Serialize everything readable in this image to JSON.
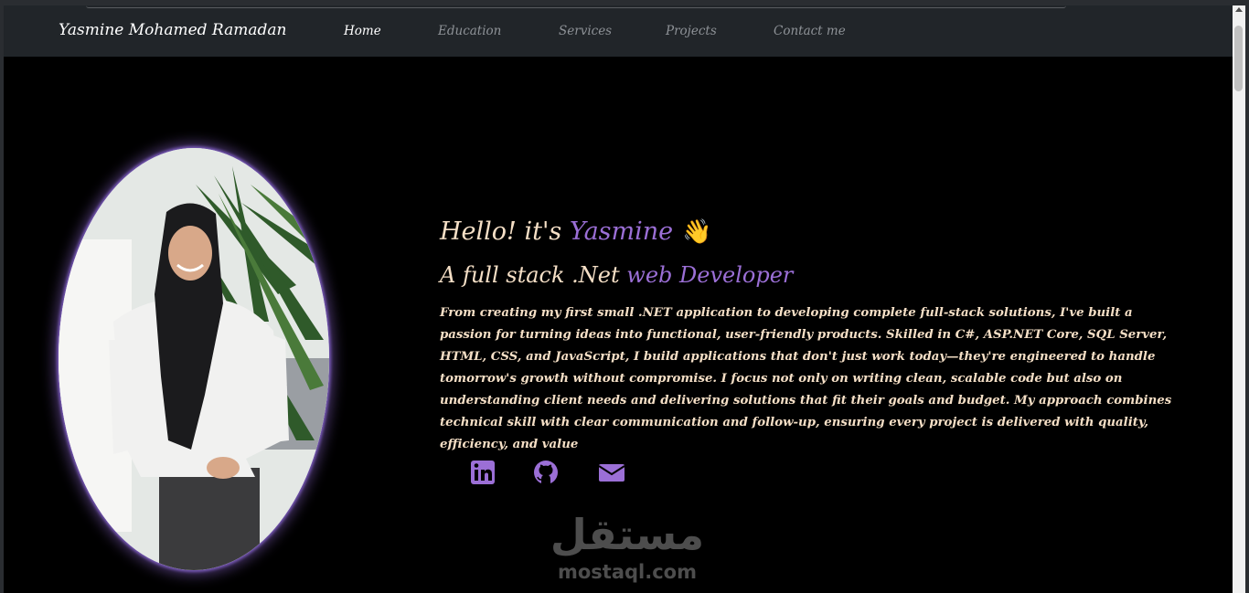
{
  "navbar": {
    "brand": "Yasmine Mohamed Ramadan",
    "links": [
      {
        "label": "Home",
        "active": true
      },
      {
        "label": "Education",
        "active": false
      },
      {
        "label": "Services",
        "active": false
      },
      {
        "label": "Projects",
        "active": false
      },
      {
        "label": "Contact me",
        "active": false
      }
    ]
  },
  "hero": {
    "greeting_prefix": "Hello! it's ",
    "greeting_name": "Yasmine",
    "wave": "👋",
    "subtitle_prefix": "A full stack .Net ",
    "subtitle_accent": "web Developer",
    "bio": "From creating my first small .NET application to developing complete full-stack solutions, I've built a passion for turning ideas into functional, user-friendly products. Skilled in C#, ASP.NET Core, SQL Server, HTML, CSS, and JavaScript, I build applications that don't just work today—they're engineered to handle tomorrow's growth without compromise. I focus not only on writing clean, scalable code but also on understanding client needs and delivering solutions that fit their goals and budget. My approach combines technical skill with clear communication and follow-up, ensuring every project is delivered with quality, efficiency, and value"
  },
  "socials": [
    {
      "icon": "linkedin-icon"
    },
    {
      "icon": "github-icon"
    },
    {
      "icon": "envelope-icon"
    }
  ],
  "watermark": {
    "arabic": "مستقل",
    "latin": "mostaql.com"
  },
  "colors": {
    "accent": "#9b6fd6",
    "text": "#f5dfc6",
    "navbar": "#212529",
    "background": "#000000"
  }
}
